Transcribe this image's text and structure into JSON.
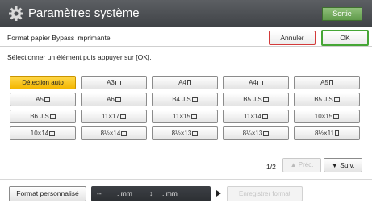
{
  "header": {
    "title": "Paramètres système",
    "exit_label": "Sortie",
    "icon": "gear-icon"
  },
  "subheader": {
    "title": "Format papier Bypass imprimante",
    "cancel_label": "Annuler",
    "ok_label": "OK"
  },
  "instruction": "Sélectionner un élément puis appuyer sur [OK].",
  "paper_sizes": [
    {
      "label": "Détection auto",
      "orient": "",
      "selected": true
    },
    {
      "label": "A3",
      "orient": "landscape",
      "selected": false
    },
    {
      "label": "A4",
      "orient": "portrait",
      "selected": false
    },
    {
      "label": "A4",
      "orient": "landscape",
      "selected": false
    },
    {
      "label": "A5",
      "orient": "portrait",
      "selected": false
    },
    {
      "label": "A5",
      "orient": "landscape",
      "selected": false
    },
    {
      "label": "A6",
      "orient": "landscape",
      "selected": false
    },
    {
      "label": "B4 JIS",
      "orient": "landscape",
      "selected": false
    },
    {
      "label": "B5 JIS",
      "orient": "landscape",
      "selected": false
    },
    {
      "label": "B5 JIS",
      "orient": "landscape",
      "selected": false
    },
    {
      "label": "B6 JIS",
      "orient": "landscape",
      "selected": false
    },
    {
      "label": "11×17",
      "orient": "landscape",
      "selected": false
    },
    {
      "label": "11×15",
      "orient": "landscape",
      "selected": false
    },
    {
      "label": "11×14",
      "orient": "landscape",
      "selected": false
    },
    {
      "label": "10×15",
      "orient": "landscape",
      "selected": false
    },
    {
      "label": "10×14",
      "orient": "landscape",
      "selected": false
    },
    {
      "label": "8½×14",
      "orient": "landscape",
      "selected": false
    },
    {
      "label": "8½×13",
      "orient": "landscape",
      "selected": false
    },
    {
      "label": "8¼×13",
      "orient": "landscape",
      "selected": false
    },
    {
      "label": "8½×11",
      "orient": "portrait",
      "selected": false
    }
  ],
  "pager": {
    "page_text": "1/2",
    "prev_label": "▲ Préc.",
    "next_label": "▼ Suiv."
  },
  "custom": {
    "button_label": "Format personnalisé",
    "dash": "--",
    "mm1": ". mm",
    "sep": "↕",
    "mm2": ". mm",
    "save_label": "Enregistrer format"
  },
  "colors": {
    "selected": "#f3b600",
    "title_bar": "#4a4d51",
    "ok_border": "#46a636",
    "cancel_border": "#d33a3a"
  }
}
